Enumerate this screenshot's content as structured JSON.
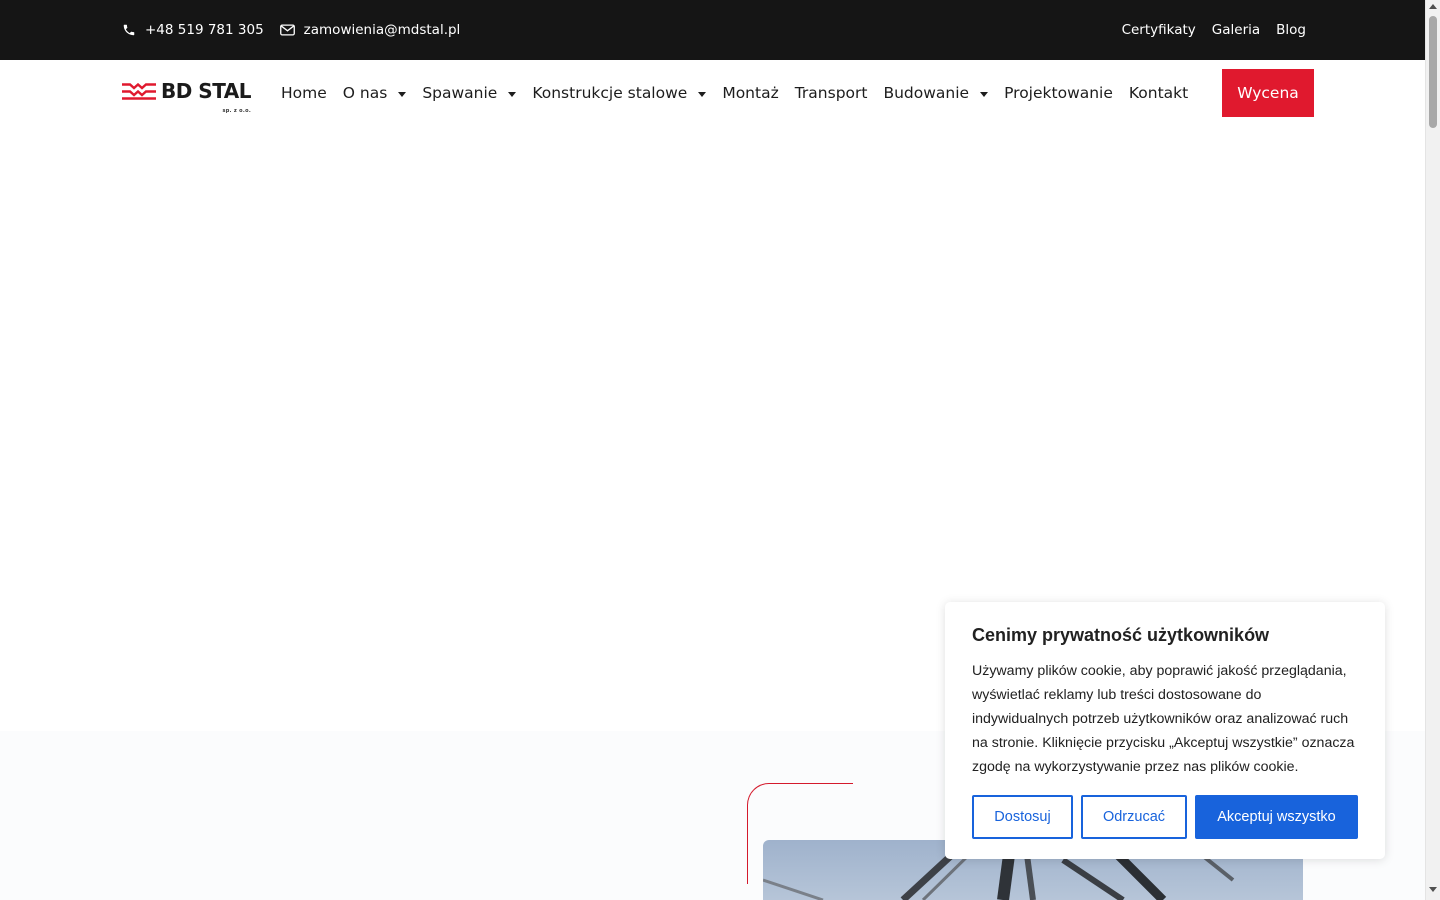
{
  "topbar": {
    "phone": "+48 519 781 305",
    "email": "zamowienia@mdstal.pl",
    "links": [
      "Certyfikaty",
      "Galeria",
      "Blog"
    ]
  },
  "logo": {
    "text": "BD STAL",
    "sub": "sp. z o.o."
  },
  "nav": {
    "items": [
      {
        "label": "Home",
        "dropdown": false
      },
      {
        "label": "O nas",
        "dropdown": true
      },
      {
        "label": "Spawanie",
        "dropdown": true
      },
      {
        "label": "Konstrukcje stalowe",
        "dropdown": true
      },
      {
        "label": "Montaż",
        "dropdown": false
      },
      {
        "label": "Transport",
        "dropdown": false
      },
      {
        "label": "Budowanie",
        "dropdown": true
      },
      {
        "label": "Projektowanie",
        "dropdown": false
      },
      {
        "label": "Kontakt",
        "dropdown": false
      }
    ],
    "cta": "Wycena"
  },
  "cookie": {
    "title": "Cenimy prywatność użytkowników",
    "text": "Używamy plików cookie, aby poprawić jakość przeglądania, wyświetlać reklamy lub treści dostosowane do indywidualnych potrzeb użytkowników oraz analizować ruch na stronie. Kliknięcie przycisku „Akceptuj wszystkie” oznacza zgodę na wykorzystywanie przez nas plików cookie.",
    "customize": "Dostosuj",
    "reject": "Odrzucać",
    "accept": "Akceptuj wszystko"
  },
  "colors": {
    "topbar_bg": "#151515",
    "brand_red": "#e0192e",
    "cookie_blue": "#1863dc"
  }
}
